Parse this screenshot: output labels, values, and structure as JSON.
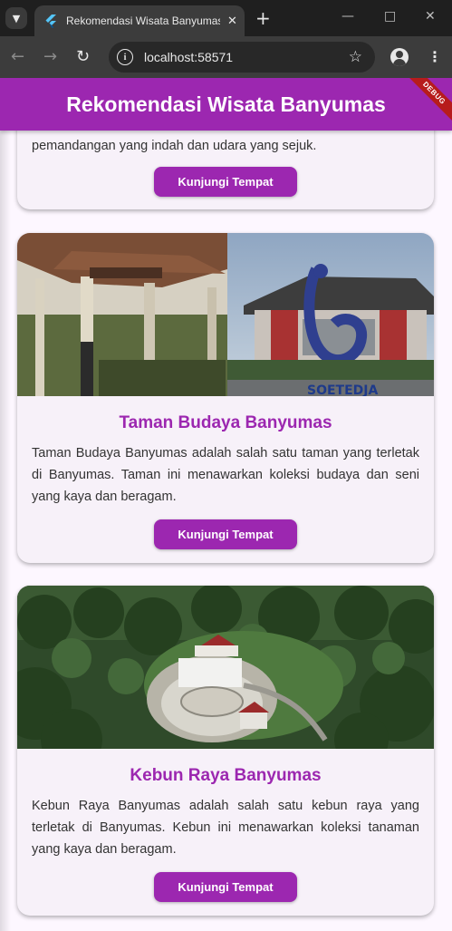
{
  "browser": {
    "tab_title": "Rekomendasi Wisata Banyumas",
    "url": "localhost:58571"
  },
  "app": {
    "title": "Rekomendasi Wisata Banyumas",
    "debug_banner": "DEBUG",
    "colors": {
      "primary": "#9c27b0",
      "card": "#f7f1f9",
      "debug": "#b71c1c"
    }
  },
  "cards": [
    {
      "title": "",
      "description": "pemandangan yang indah dan udara yang sejuk.",
      "button": "Kunjungi Tempat"
    },
    {
      "title": "Taman Budaya Banyumas",
      "description": "Taman Budaya Banyumas adalah salah satu taman yang terletak di Banyumas. Taman ini menawarkan koleksi budaya dan seni yang kaya dan beragam.",
      "image_caption": "SOETEDJA",
      "button": "Kunjungi Tempat"
    },
    {
      "title": "Kebun Raya Banyumas",
      "description": "Kebun Raya Banyumas adalah salah satu kebun raya yang terletak di Banyumas. Kebun ini menawarkan koleksi tanaman yang kaya dan beragam.",
      "button": "Kunjungi Tempat"
    }
  ]
}
